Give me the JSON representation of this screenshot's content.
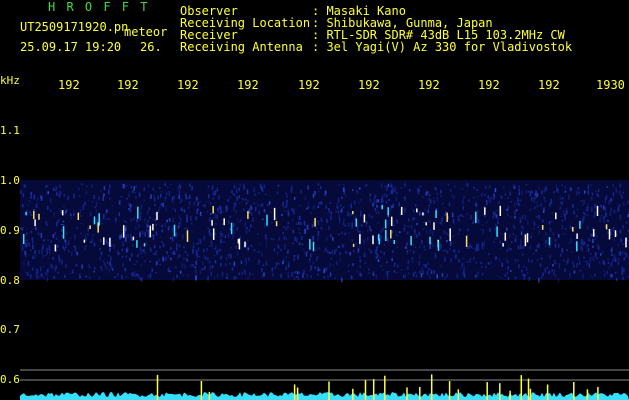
{
  "header": {
    "app_name": "H R O F F T",
    "filename": "UT2509171920.pn",
    "meteor_label": "meteor",
    "datetime": "25.09.17 19:20",
    "count": "26.",
    "fields": [
      {
        "label": "Observer",
        "value": ": Masaki Kano"
      },
      {
        "label": "Receiving Location",
        "value": ": Shibukawa, Gunma, Japan"
      },
      {
        "label": "Receiver",
        "value": ": RTL-SDR SDR# 43dB L15 103.2MHz CW"
      },
      {
        "label": "Receiving Antenna",
        "value": ": 3el Yagi(V) Az 330 for Vladivostok"
      }
    ]
  },
  "axes": {
    "y_unit": "kHz",
    "x_ticks": [
      "192",
      "192",
      "192",
      "192",
      "192",
      "192",
      "192",
      "192",
      "192",
      "1930"
    ],
    "y_ticks": [
      "1.1",
      "1.0",
      "0.9",
      "0.8",
      "0.7",
      "0.6"
    ]
  },
  "colors": {
    "text_green": "#3fdc3f",
    "text_yellow": "#ffff3a",
    "noise_blue": "#1a2aa0",
    "signal_cyan": "#33e0ff",
    "guide_line": "#8a8a8a"
  }
}
